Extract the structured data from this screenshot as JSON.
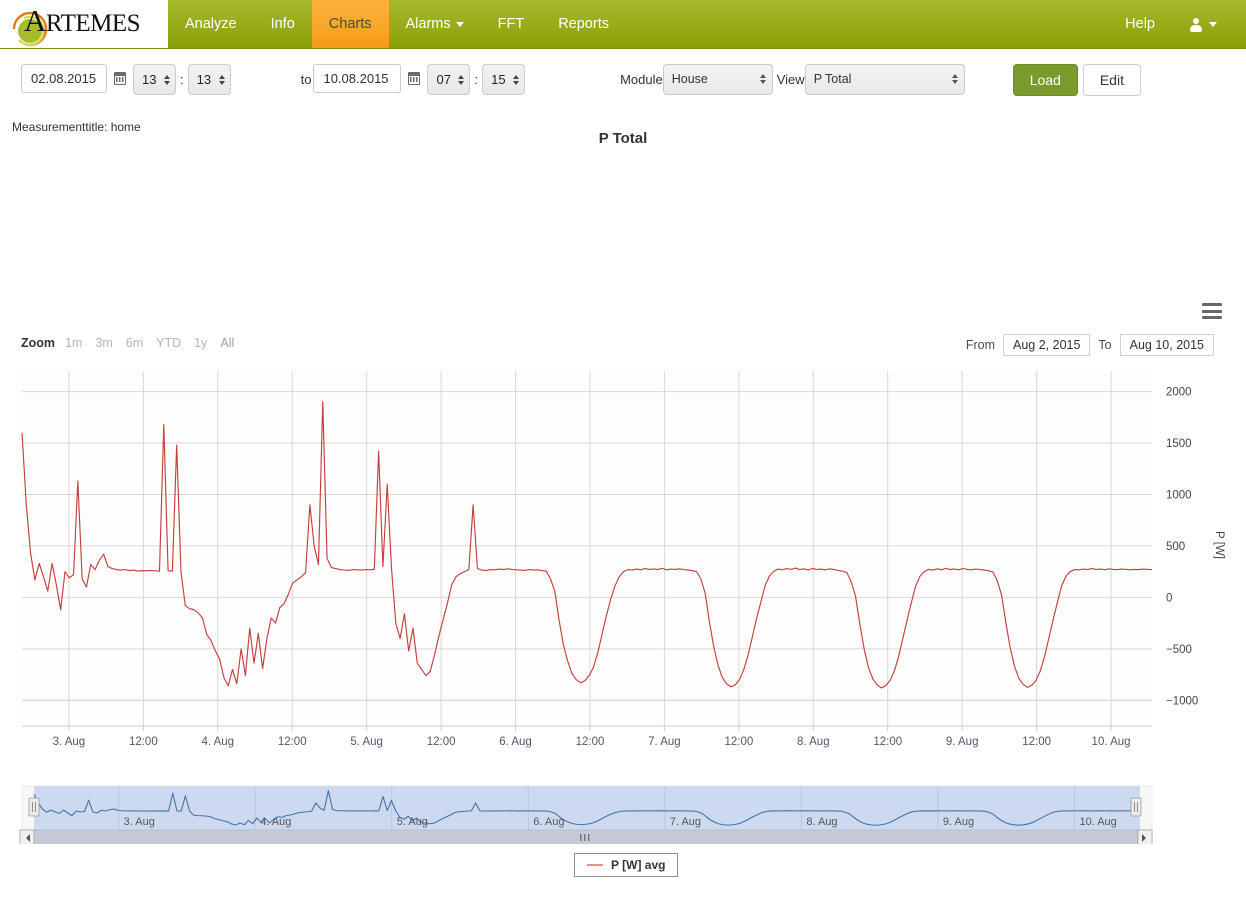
{
  "brand": {
    "name_main": "A",
    "name_rest": "RTEMES",
    "logo_icon": "artemes-swirl-logo"
  },
  "nav": {
    "items": [
      {
        "label": "Analyze",
        "active": false,
        "dropdown": false
      },
      {
        "label": "Info",
        "active": false,
        "dropdown": false
      },
      {
        "label": "Charts",
        "active": true,
        "dropdown": false
      },
      {
        "label": "Alarms",
        "active": false,
        "dropdown": true
      },
      {
        "label": "FFT",
        "active": false,
        "dropdown": false
      },
      {
        "label": "Reports",
        "active": false,
        "dropdown": false
      }
    ],
    "help_label": "Help",
    "user_icon": "user-icon"
  },
  "filterbar": {
    "from_date": "02.08.2015",
    "from_date_placeholder": "dd.mm.yyyy",
    "from_hour": "13",
    "from_minute": "13",
    "to_label": "to",
    "to_date": "10.08.2015",
    "to_date_placeholder": "dd.mm.yyyy",
    "to_hour": "07",
    "to_minute": "15",
    "time_separator": ":",
    "module_label": "Module",
    "module_value": "House",
    "view_label": "View",
    "view_value": "P Total",
    "load_label": "Load",
    "edit_label": "Edit",
    "calendar_icon": "calendar-icon"
  },
  "measurement_title": "Measurementtitle: home",
  "chart_panel": {
    "menu_icon": "hamburger-menu-icon",
    "zoom_label": "Zoom",
    "zoom_options": [
      "1m",
      "3m",
      "6m",
      "YTD",
      "1y",
      "All"
    ],
    "from_label": "From",
    "from_value": "Aug 2, 2015",
    "to_label": "To",
    "to_value": "Aug 10, 2015",
    "navigator_left_handle": "navigator-left-handle",
    "navigator_right_handle": "navigator-right-handle",
    "scrollbar_left_arrow": "scrollbar-left-arrow",
    "scrollbar_right_arrow": "scrollbar-right-arrow"
  },
  "colors": {
    "brand_green": "#9aae1c",
    "active_tab_orange": "#f8a629",
    "series_line": "#c4403c",
    "navigator_line": "#4572a7",
    "navigator_fill": "#cdd9ef",
    "primary_button": "#7a9a2e"
  },
  "chart_data": {
    "type": "line",
    "title": "P Total",
    "xlabel": "",
    "ylabel": "P [W]",
    "ylim": [
      -1250,
      2200
    ],
    "yticks": [
      2000,
      1500,
      1000,
      500,
      0,
      -500,
      -1000
    ],
    "ytick_labels": [
      "2000",
      "1500",
      "1000",
      "500",
      "0",
      "−500",
      "−1000"
    ],
    "xlim": [
      "2015-08-02T13:13",
      "2015-08-10T07:15"
    ],
    "xticks": [
      "3. Aug",
      "12:00",
      "4. Aug",
      "12:00",
      "5. Aug",
      "12:00",
      "6. Aug",
      "12:00",
      "7. Aug",
      "12:00",
      "8. Aug",
      "12:00",
      "9. Aug",
      "12:00",
      "10. Aug"
    ],
    "grid": true,
    "legend_position": "bottom",
    "series": [
      {
        "name": "P [W] avg",
        "color": "#c4403c",
        "unit": "W",
        "values": [
          1600,
          900,
          430,
          170,
          330,
          200,
          60,
          330,
          120,
          -120,
          250,
          190,
          220,
          1130,
          180,
          100,
          320,
          270,
          360,
          420,
          300,
          280,
          270,
          265,
          270,
          260,
          265,
          255,
          260,
          258,
          262,
          258,
          255,
          1680,
          260,
          255,
          1480,
          250,
          -80,
          -110,
          -120,
          -150,
          -200,
          -360,
          -420,
          -520,
          -600,
          -780,
          -860,
          -700,
          -840,
          -500,
          -760,
          -300,
          -640,
          -350,
          -690,
          -400,
          -200,
          -250,
          -100,
          -60,
          30,
          140,
          170,
          200,
          240,
          900,
          500,
          320,
          1900,
          380,
          290,
          280,
          270,
          265,
          262,
          270,
          268,
          265,
          270,
          268,
          272,
          1420,
          300,
          1100,
          280,
          -250,
          -400,
          -160,
          -520,
          -300,
          -640,
          -700,
          -760,
          -720,
          -560,
          -380,
          -220,
          -60,
          120,
          200,
          230,
          250,
          270,
          900,
          280,
          265,
          260,
          270,
          268,
          275,
          270,
          278,
          272,
          268,
          265,
          262,
          270,
          265,
          268,
          260,
          255,
          180,
          60,
          -220,
          -460,
          -620,
          -740,
          -800,
          -830,
          -810,
          -760,
          -680,
          -540,
          -360,
          -180,
          -20,
          110,
          200,
          250,
          270,
          265,
          275,
          268,
          280,
          272,
          276,
          270,
          282,
          268,
          275,
          272,
          278,
          270,
          265,
          260,
          250,
          180,
          40,
          -240,
          -480,
          -660,
          -780,
          -840,
          -870,
          -850,
          -800,
          -700,
          -560,
          -380,
          -200,
          -40,
          120,
          210,
          255,
          275,
          268,
          280,
          272,
          285,
          270,
          278,
          265,
          282,
          270,
          275,
          268,
          278,
          270,
          262,
          255,
          240,
          150,
          10,
          -260,
          -500,
          -680,
          -790,
          -850,
          -880,
          -860,
          -810,
          -720,
          -580,
          -400,
          -220,
          -50,
          110,
          205,
          250,
          272,
          265,
          278,
          268,
          282,
          270,
          276,
          268,
          280,
          272,
          268,
          275,
          270,
          265,
          258,
          245,
          160,
          20,
          -250,
          -490,
          -670,
          -785,
          -845,
          -875,
          -855,
          -805,
          -715,
          -575,
          -395,
          -215,
          -45,
          115,
          208,
          252,
          270,
          268,
          275,
          270,
          280,
          272,
          275,
          268,
          278,
          272,
          270,
          275,
          272,
          268,
          272,
          270,
          275,
          272,
          270
        ]
      }
    ],
    "navigator": {
      "name": "navigator-series",
      "color": "#4572a7",
      "fill": "#cdd9ef",
      "xticks": [
        "3. Aug",
        "4. Aug",
        "5. Aug",
        "6. Aug",
        "7. Aug",
        "8. Aug",
        "9. Aug",
        "10. Aug"
      ]
    },
    "legend": [
      {
        "label": "P [W] avg",
        "color": "#e2948f"
      }
    ]
  }
}
